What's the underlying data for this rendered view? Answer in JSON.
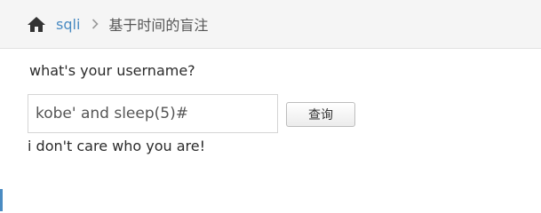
{
  "breadcrumb": {
    "home_icon": "home-icon",
    "link_label": "sqli",
    "separator_icon": "chevron-right-icon",
    "current_label": "基于时间的盲注"
  },
  "form": {
    "question": "what's your username?",
    "input_value": "kobe' and sleep(5)#",
    "button_label": "查询"
  },
  "result": {
    "message": "i don't care who you are!"
  },
  "colors": {
    "link": "#4a8bc2",
    "breadcrumb_bg": "#f5f5f5"
  }
}
